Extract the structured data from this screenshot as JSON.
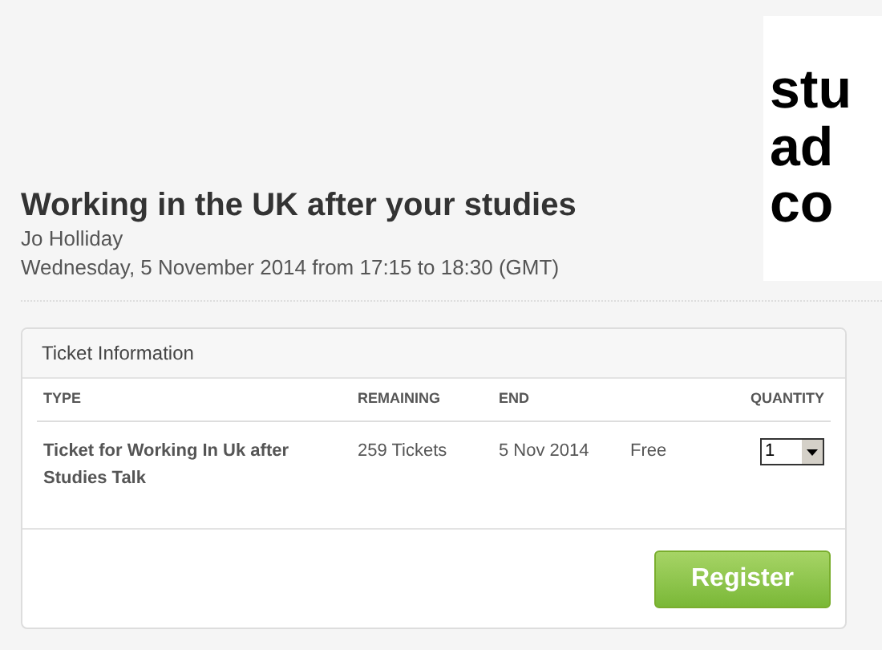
{
  "logo": {
    "lines": [
      "stu",
      "ad",
      "co"
    ]
  },
  "event": {
    "title": "Working in the UK after your studies",
    "organizer": "Jo Holliday",
    "date": "Wednesday, 5 November 2014 from 17:15 to 18:30 (GMT)"
  },
  "ticket_panel": {
    "title": "Ticket Information",
    "columns": [
      "TYPE",
      "REMAINING",
      "END",
      "QUANTITY"
    ],
    "rows": [
      {
        "type": "Ticket for Working In Uk after Studies Talk",
        "remaining": "259 Tickets",
        "end": "5 Nov 2014",
        "price": "Free",
        "quantity": "1"
      }
    ],
    "button": "Register"
  }
}
